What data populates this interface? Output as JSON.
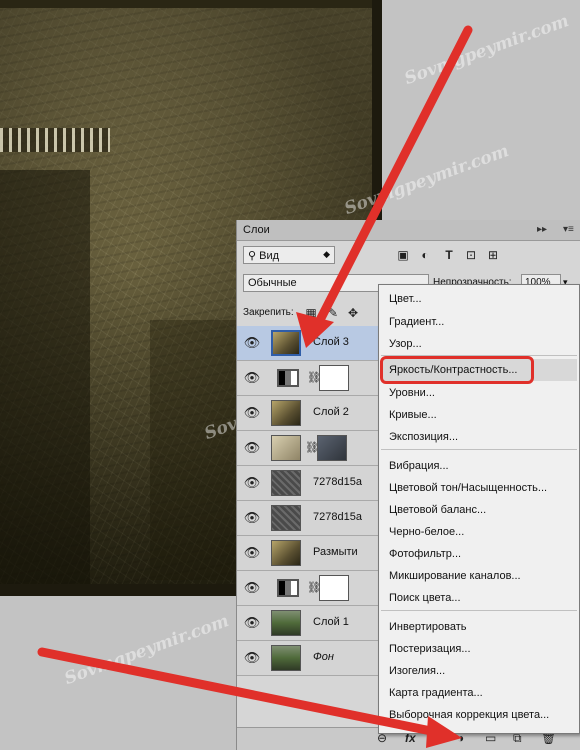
{
  "watermark": "Sovmgpeymir.com",
  "panel": {
    "tab": "Слои",
    "filter_kind": "Вид",
    "blend_mode": "Обычные",
    "opacity_label": "Непрозрачность:",
    "opacity_value": "100%",
    "lock_label": "Закрепить:"
  },
  "layers": [
    {
      "name": "Слой 3",
      "selected": true
    },
    {
      "name": "",
      "selected": false
    },
    {
      "name": "Слой 2",
      "selected": false
    },
    {
      "name": "",
      "selected": false
    },
    {
      "name": "7278d15a",
      "selected": false
    },
    {
      "name": "7278d15a",
      "selected": false
    },
    {
      "name": "Размыти",
      "selected": false
    },
    {
      "name": "",
      "selected": false
    },
    {
      "name": "Слой 1",
      "selected": false
    },
    {
      "name": "Фон",
      "selected": false
    }
  ],
  "footer": {
    "fx": "fx"
  },
  "menu": {
    "items": [
      "Цвет...",
      "Градиент...",
      "Узор...",
      "Яркость/Контрастность...",
      "Уровни...",
      "Кривые...",
      "Экспозиция...",
      "Вибрация...",
      "Цветовой тон/Насыщенность...",
      "Цветовой баланс...",
      "Черно-белое...",
      "Фотофильтр...",
      "Микширование каналов...",
      "Поиск цвета...",
      "Инвертировать",
      "Постеризация...",
      "Изогелия...",
      "Карта градиента...",
      "Выборочная коррекция цвета..."
    ],
    "highlighted_item": "Яркость/Контрастность..."
  },
  "colors": {
    "arrow": "#e0302a",
    "selection": "#b8c9e3"
  }
}
